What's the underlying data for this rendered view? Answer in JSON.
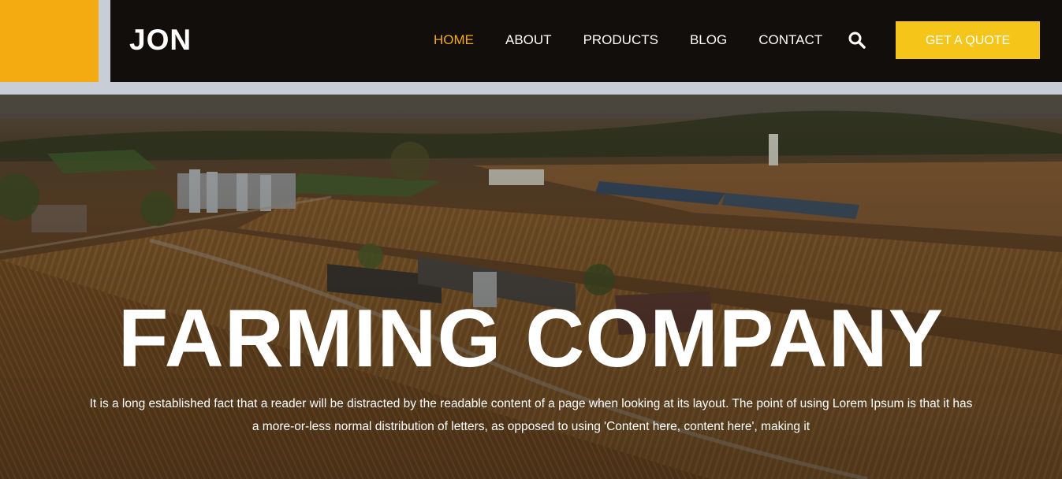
{
  "header": {
    "brand": "JON",
    "nav": [
      "HOME",
      "ABOUT",
      "PRODUCTS",
      "BLOG",
      "CONTACT"
    ],
    "active_index": 0,
    "search_icon": "search-icon",
    "cta_label": "GET A QUOTE"
  },
  "hero": {
    "title": "FARMING COMPANY",
    "description": "It is a long established fact that a reader will be distracted by the readable content of a page when looking at its layout. The point of using Lorem Ipsum is that it has a more-or-less normal distribution of letters, as opposed to using 'Content here, content here', making it"
  },
  "colors": {
    "accent": "#f4ab12",
    "cta": "#f5c619",
    "header_bg": "#110e0c"
  }
}
